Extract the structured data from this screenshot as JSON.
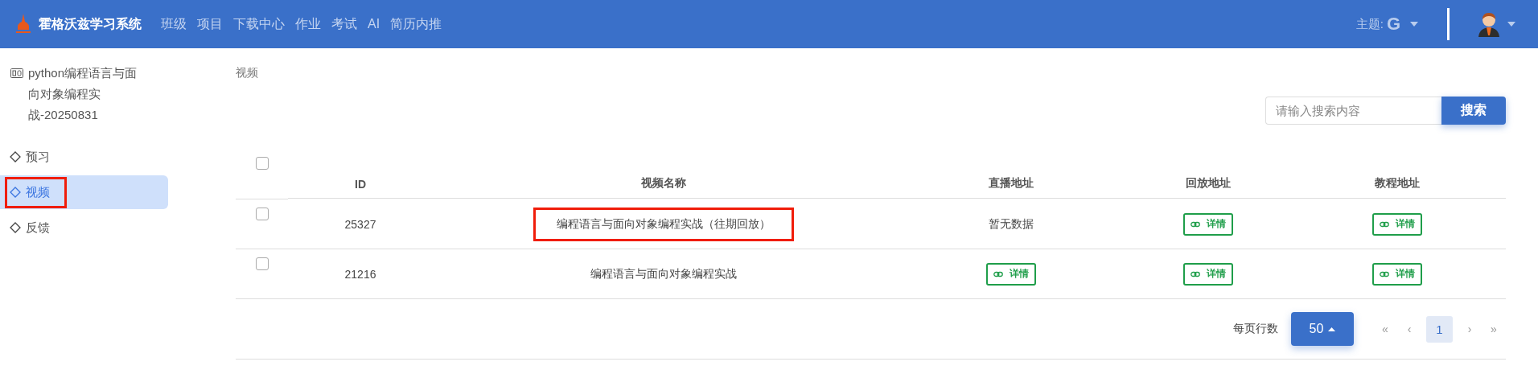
{
  "header": {
    "brand": "霍格沃兹学习系统",
    "nav": [
      {
        "label": "班级"
      },
      {
        "label": "项目"
      },
      {
        "label": "下载中心"
      },
      {
        "label": "作业"
      },
      {
        "label": "考试"
      },
      {
        "label": "AI"
      },
      {
        "label": "简历内推"
      }
    ],
    "theme_label": "主题:",
    "theme_value": "G"
  },
  "sidebar": {
    "course_title": "python编程语言与面向对象编程实战-20250831",
    "items": [
      {
        "label": "预习",
        "selected": false,
        "annotated": false
      },
      {
        "label": "视频",
        "selected": true,
        "annotated": true
      },
      {
        "label": "反馈",
        "selected": false,
        "annotated": false
      }
    ]
  },
  "breadcrumb": "视频",
  "search": {
    "placeholder": "请输入搜索内容",
    "button": "搜索"
  },
  "table": {
    "select_all_checked": false,
    "columns": [
      "ID",
      "视频名称",
      "直播地址",
      "回放地址",
      "教程地址"
    ],
    "rows": [
      {
        "checked": false,
        "id": "25327",
        "name": "编程语言与面向对象编程实战（往期回放）",
        "name_annotated": true,
        "live": {
          "kind": "text",
          "text": "暂无数据"
        },
        "replay": {
          "kind": "link",
          "text": "详情"
        },
        "tutorial": {
          "kind": "link",
          "text": "详情"
        }
      },
      {
        "checked": false,
        "id": "21216",
        "name": "编程语言与面向对象编程实战",
        "name_annotated": false,
        "live": {
          "kind": "link",
          "text": "详情"
        },
        "replay": {
          "kind": "link",
          "text": "详情"
        },
        "tutorial": {
          "kind": "link",
          "text": "详情"
        }
      }
    ]
  },
  "pagination": {
    "rows_per_page_label": "每页行数",
    "rows_per_page": "50",
    "first": "«",
    "prev": "‹",
    "next": "›",
    "last": "»",
    "pages": [
      {
        "label": "1",
        "selected": true
      }
    ]
  }
}
